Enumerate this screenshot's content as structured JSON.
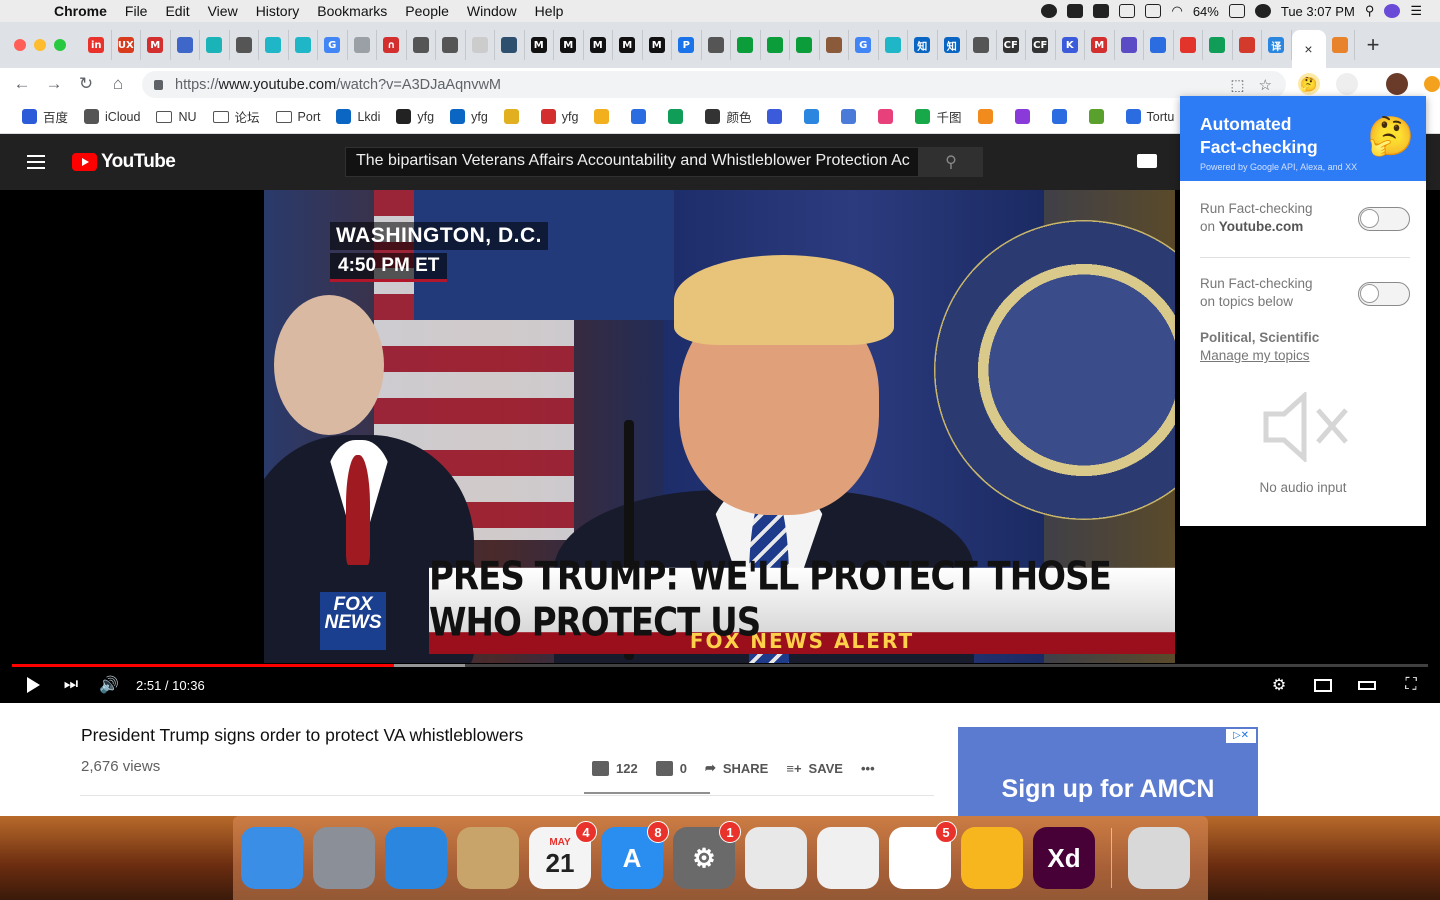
{
  "menubar": {
    "app": "Chrome",
    "items": [
      "File",
      "Edit",
      "View",
      "History",
      "Bookmarks",
      "People",
      "Window",
      "Help"
    ],
    "battery": "64%",
    "clock": "Tue 3:07 PM"
  },
  "tabs": {
    "favicons": [
      {
        "label": "in",
        "color": "#e8322b"
      },
      {
        "label": "UX",
        "color": "#d93b1d"
      },
      {
        "label": "M",
        "color": "#d32f2f"
      },
      {
        "label": "",
        "color": "#3f67c9"
      },
      {
        "label": "",
        "color": "#19b3b8"
      },
      {
        "label": "",
        "color": "#555555"
      },
      {
        "label": "",
        "color": "#1fb6c8"
      },
      {
        "label": "",
        "color": "#1fb6c8"
      },
      {
        "label": "G",
        "color": "#4285f4"
      },
      {
        "label": "",
        "color": "#9aa0a6"
      },
      {
        "label": "∩",
        "color": "#d32f2f"
      },
      {
        "label": "",
        "color": "#555555"
      },
      {
        "label": "",
        "color": "#555555"
      },
      {
        "label": "",
        "color": "#cccccc"
      },
      {
        "label": "",
        "color": "#2f4f6f"
      },
      {
        "label": "M",
        "color": "#111111"
      },
      {
        "label": "M",
        "color": "#111111"
      },
      {
        "label": "M",
        "color": "#111111"
      },
      {
        "label": "M",
        "color": "#111111"
      },
      {
        "label": "M",
        "color": "#111111"
      },
      {
        "label": "P",
        "color": "#1a73e8"
      },
      {
        "label": "",
        "color": "#555555"
      },
      {
        "label": "",
        "color": "#0a9d3a"
      },
      {
        "label": "",
        "color": "#0a9d3a"
      },
      {
        "label": "",
        "color": "#0a9d3a"
      },
      {
        "label": "",
        "color": "#8a5a3a"
      },
      {
        "label": "G",
        "color": "#4285f4"
      },
      {
        "label": "",
        "color": "#1fb6c8"
      },
      {
        "label": "知",
        "color": "#0a66c2"
      },
      {
        "label": "知",
        "color": "#0a66c2"
      },
      {
        "label": "",
        "color": "#555555"
      },
      {
        "label": "CF",
        "color": "#333333"
      },
      {
        "label": "CF",
        "color": "#333333"
      },
      {
        "label": "K",
        "color": "#3b5bdb"
      },
      {
        "label": "M",
        "color": "#d32f2f"
      },
      {
        "label": "",
        "color": "#5b4bc4"
      },
      {
        "label": "",
        "color": "#2b6de0"
      },
      {
        "label": "",
        "color": "#e2342a"
      },
      {
        "label": "",
        "color": "#0f9d58"
      },
      {
        "label": "",
        "color": "#d33a2c"
      },
      {
        "label": "译",
        "color": "#2b86e0"
      }
    ],
    "active_close": "×",
    "after_active": {
      "label": "",
      "color": "#e8822b"
    },
    "new_tab": "+"
  },
  "toolbar": {
    "back": "←",
    "forward": "→",
    "reload": "↻",
    "home": "⌂",
    "url_scheme": "https://",
    "url_host": "www.youtube.com",
    "url_path": "/watch?v=A3DJaAqnvwM",
    "translate": "⬚",
    "star": "☆",
    "ext_emoji": "🤔"
  },
  "bookmarks": [
    {
      "label": "百度",
      "icon": "#2b5bd8",
      "type": "site"
    },
    {
      "label": "iCloud",
      "icon": "#555555",
      "type": "site"
    },
    {
      "label": "NU",
      "icon": "",
      "type": "folder"
    },
    {
      "label": "论坛",
      "icon": "",
      "type": "folder"
    },
    {
      "label": "Port",
      "icon": "",
      "type": "folder"
    },
    {
      "label": "Lkdi",
      "icon": "#0a66c2",
      "type": "site"
    },
    {
      "label": "yfg",
      "icon": "#222222",
      "type": "site"
    },
    {
      "label": "yfg",
      "icon": "#0a66c2",
      "type": "site"
    },
    {
      "label": "",
      "icon": "#e0b020",
      "type": "site"
    },
    {
      "label": "yfg",
      "icon": "#d32f2f",
      "type": "site"
    },
    {
      "label": "",
      "icon": "#f2b01e",
      "type": "site"
    },
    {
      "label": "",
      "icon": "#2b6de0",
      "type": "site"
    },
    {
      "label": "",
      "icon": "#0f9d58",
      "type": "site"
    },
    {
      "label": "颜色",
      "icon": "#333333",
      "type": "site"
    },
    {
      "label": "",
      "icon": "#3b5bdb",
      "type": "site"
    },
    {
      "label": "",
      "icon": "#2b86e0",
      "type": "site"
    },
    {
      "label": "",
      "icon": "#4a7bd8",
      "type": "site"
    },
    {
      "label": "",
      "icon": "#e8407a",
      "type": "site"
    },
    {
      "label": "千图",
      "icon": "#17a84a",
      "type": "site"
    },
    {
      "label": "",
      "icon": "#f28b1e",
      "type": "site"
    },
    {
      "label": "",
      "icon": "#8a3ad8",
      "type": "site"
    },
    {
      "label": "",
      "icon": "#2b6de0",
      "type": "site"
    },
    {
      "label": "",
      "icon": "#5aa02c",
      "type": "site"
    },
    {
      "label": "Tortu",
      "icon": "#2b6de0",
      "type": "site"
    },
    {
      "label": "",
      "icon": "#333333",
      "type": "site"
    }
  ],
  "youtube": {
    "logo_text": "YouTube",
    "search_value": "The bipartisan Veterans Affairs Accountability and Whistleblower Protection Ac",
    "search_icon": "⚲"
  },
  "video": {
    "location_line": "WASHINGTON, D.C.",
    "time_line": "4:50 PM ET",
    "fox_logo": "FOX NEWS",
    "chyron_main": "PRES TRUMP: WE'LL PROTECT THOSE WHO PROTECT US",
    "chyron_sub": "FOX NEWS ALERT",
    "time_display": "2:51 / 10:36",
    "progress_played": 0.27,
    "progress_buffered": 0.32
  },
  "info": {
    "title": "President Trump signs order to protect VA whistleblowers",
    "views": "2,676 views",
    "likes": "122",
    "dislikes": "0",
    "share": "SHARE",
    "save": "SAVE",
    "more": "•••"
  },
  "ad": {
    "text": "Sign up for AMCN",
    "badge": "▷✕"
  },
  "popup": {
    "title_line1": "Automated",
    "title_line2": "Fact-checking",
    "subtitle": "Powered by Google API, Alexa, and XX",
    "emoji": "🤔",
    "setting1_prefix": "Run Fact-checking",
    "setting1_on": "on ",
    "setting1_site": "Youtube.com",
    "setting1_enabled": false,
    "setting2_line1": "Run Fact-checking",
    "setting2_line2": "on topics below",
    "setting2_enabled": false,
    "topics": "Political, Scientific",
    "manage_link": "Manage my topics",
    "no_audio": "No audio input"
  },
  "dock": {
    "apps": [
      {
        "name": "finder",
        "label": "",
        "color": "#3a8ee6",
        "badge": ""
      },
      {
        "name": "launchpad",
        "label": "",
        "color": "#8a8f98",
        "badge": ""
      },
      {
        "name": "safari",
        "label": "",
        "color": "#2b86e0",
        "badge": ""
      },
      {
        "name": "contacts",
        "label": "",
        "color": "#c8a46a",
        "badge": ""
      },
      {
        "name": "calendar",
        "label": "21",
        "color": "#f4f4f4",
        "badge": "4"
      },
      {
        "name": "app-store",
        "label": "A",
        "color": "#2a8ef0",
        "badge": "8"
      },
      {
        "name": "system-preferences",
        "label": "⚙",
        "color": "#6a6a6a",
        "badge": "1"
      },
      {
        "name": "chrome",
        "label": "",
        "color": "#e8e8e8",
        "badge": ""
      },
      {
        "name": "wechat",
        "label": "",
        "color": "#f0f0f0",
        "badge": ""
      },
      {
        "name": "slack",
        "label": "",
        "color": "#ffffff",
        "badge": "5"
      },
      {
        "name": "sketch",
        "label": "",
        "color": "#f7b51e",
        "badge": ""
      },
      {
        "name": "adobe-xd",
        "label": "Xd",
        "color": "#470137",
        "badge": ""
      },
      {
        "name": "trash",
        "label": "",
        "color": "#d8d8d8",
        "badge": ""
      }
    ],
    "calendar_month": "MAY"
  }
}
